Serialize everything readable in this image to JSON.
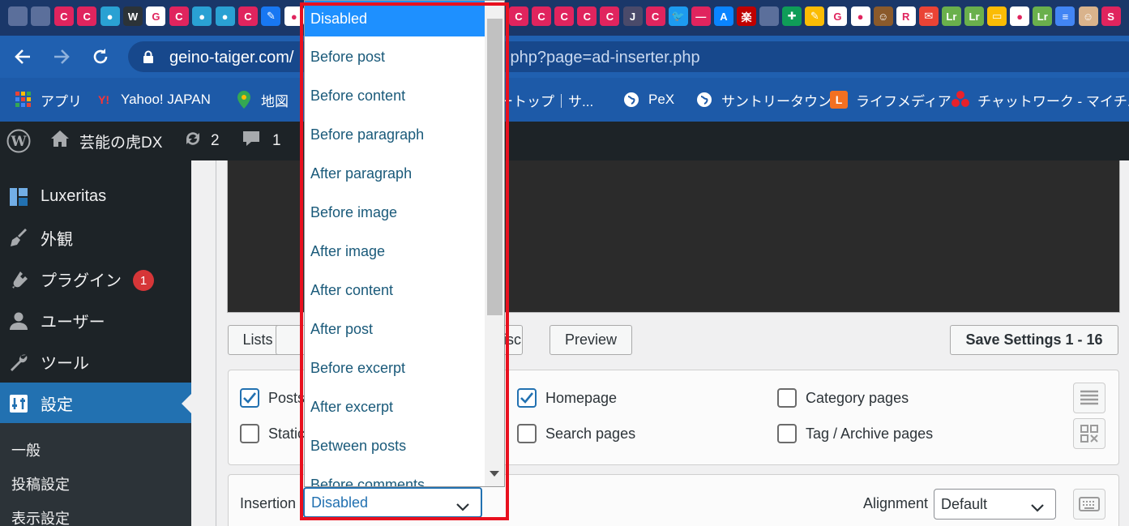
{
  "browser": {
    "url_host": "geino-taiger.com/",
    "url_tail": ".php?page=ad-inserter.php",
    "tab_icons": [
      {
        "name": "wp-icon",
        "glyph": "",
        "bg": "#5b6f9b"
      },
      {
        "name": "wp-icon",
        "glyph": "",
        "bg": "#5b6f9b"
      },
      {
        "name": "c-icon",
        "glyph": "C",
        "bg": "#e0245e"
      },
      {
        "name": "c-icon",
        "glyph": "C",
        "bg": "#e0245e"
      },
      {
        "name": "circle-icon",
        "glyph": "●",
        "bg": "#2aa1d3"
      },
      {
        "name": "wordpress-icon",
        "glyph": "W",
        "bg": "#2c3338"
      },
      {
        "name": "google-icon",
        "glyph": "G",
        "bg": "#ffffff"
      },
      {
        "name": "c-icon",
        "glyph": "C",
        "bg": "#e0245e"
      },
      {
        "name": "circle-icon",
        "glyph": "●",
        "bg": "#2aa1d3"
      },
      {
        "name": "circle-icon",
        "glyph": "●",
        "bg": "#2aa1d3"
      },
      {
        "name": "c-icon",
        "glyph": "C",
        "bg": "#e0245e"
      },
      {
        "name": "feather-icon",
        "glyph": "✎",
        "bg": "#1877f2"
      },
      {
        "name": "globe-icon",
        "glyph": "●",
        "bg": "#ffffff"
      }
    ],
    "tab_icons_right": [
      {
        "name": "c-icon",
        "glyph": "C",
        "bg": "#e0245e"
      },
      {
        "name": "c-icon",
        "glyph": "C",
        "bg": "#e0245e"
      },
      {
        "name": "c-icon",
        "glyph": "C",
        "bg": "#e0245e"
      },
      {
        "name": "c-icon",
        "glyph": "C",
        "bg": "#e0245e"
      },
      {
        "name": "c-icon",
        "glyph": "C",
        "bg": "#e0245e"
      },
      {
        "name": "j-icon",
        "glyph": "J",
        "bg": "#4a4a6a"
      },
      {
        "name": "c-icon",
        "glyph": "C",
        "bg": "#e0245e"
      },
      {
        "name": "twitter-icon",
        "glyph": "🐦",
        "bg": "#1d9bf0"
      },
      {
        "name": "line-icon",
        "glyph": "—",
        "bg": "#e0245e"
      },
      {
        "name": "app-store-icon",
        "glyph": "A",
        "bg": "#0a84ff"
      },
      {
        "name": "rakuten-icon",
        "glyph": "楽",
        "bg": "#bf0000"
      },
      {
        "name": "wp-icon",
        "glyph": "",
        "bg": "#5b6f9b"
      },
      {
        "name": "plus-icon",
        "glyph": "✚",
        "bg": "#0f9d58"
      },
      {
        "name": "pencil-icon",
        "glyph": "✎",
        "bg": "#fbbc04"
      },
      {
        "name": "google-icon",
        "glyph": "G",
        "bg": "#ffffff"
      },
      {
        "name": "globe-icon",
        "glyph": "●",
        "bg": "#ffffff"
      },
      {
        "name": "avatar-icon",
        "glyph": "☺",
        "bg": "#8b5a2b"
      },
      {
        "name": "r-icon",
        "glyph": "R",
        "bg": "#ffffff"
      },
      {
        "name": "mail-icon",
        "glyph": "✉",
        "bg": "#ea4335"
      },
      {
        "name": "lt-icon",
        "glyph": "Lr",
        "bg": "#6ab04c"
      },
      {
        "name": "lt-icon",
        "glyph": "Lr",
        "bg": "#6ab04c"
      },
      {
        "name": "note-icon",
        "glyph": "▭",
        "bg": "#fbbc04"
      },
      {
        "name": "globe-icon",
        "glyph": "●",
        "bg": "#ffffff"
      },
      {
        "name": "lt-icon",
        "glyph": "Lr",
        "bg": "#6ab04c"
      },
      {
        "name": "docs-icon",
        "glyph": "≡",
        "bg": "#4285f4"
      },
      {
        "name": "face-icon",
        "glyph": "☺",
        "bg": "#d9b38c"
      },
      {
        "name": "s-icon",
        "glyph": "S",
        "bg": "#e0245e"
      }
    ]
  },
  "bookmarks": {
    "apps": "アプリ",
    "yahoo": "Yahoo! JAPAN",
    "maps": "地図",
    "hidden": "ートップ｜サ...",
    "pex": "PeX",
    "suntory": "サントリータウン",
    "lifemedia": "ライフメディア",
    "chatwork": "チャットワーク - マイチ..."
  },
  "adminbar": {
    "site_name": "芸能の虎DX",
    "updates": "2",
    "comments": "1"
  },
  "sidebar": {
    "items": [
      {
        "label": "Luxeritas"
      },
      {
        "label": "外観"
      },
      {
        "label": "プラグイン",
        "badge": "1"
      },
      {
        "label": "ユーザー"
      },
      {
        "label": "ツール"
      },
      {
        "label": "設定"
      }
    ],
    "submenu": [
      "一般",
      "投稿設定",
      "表示設定"
    ]
  },
  "toolbar": {
    "lists_label": "Lists",
    "hidden_label": "Misc",
    "visible_partial": "isc",
    "preview_label": "Preview",
    "save_label": "Save Settings 1 - 16"
  },
  "checkboxes": {
    "posts": "Posts",
    "static": "Static",
    "homepage": "Homepage",
    "search_pages": "Search pages",
    "category_pages": "Category pages",
    "tag_archive": "Tag / Archive pages"
  },
  "insertion": {
    "label": "Insertion",
    "value": "Disabled",
    "options": [
      "Disabled",
      "Before post",
      "Before content",
      "Before paragraph",
      "After paragraph",
      "Before image",
      "After image",
      "After content",
      "After post",
      "Before excerpt",
      "After excerpt",
      "Between posts",
      "Before comments"
    ]
  },
  "alignment": {
    "label": "Alignment",
    "value": "Default"
  },
  "colors": {
    "highlight": "#e8101e",
    "selected_option": "#1e90ff",
    "wp_blue": "#2271b1"
  }
}
